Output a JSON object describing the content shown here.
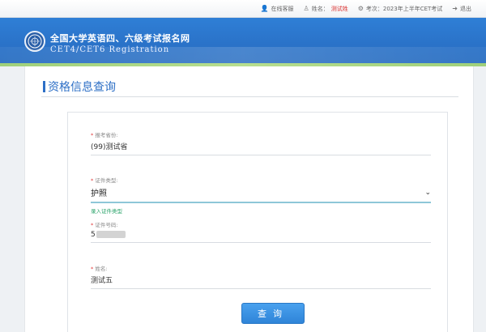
{
  "topbar": {
    "items": [
      {
        "icon": "user-icon",
        "label": "在线客服"
      },
      {
        "icon": "person-icon",
        "label": "姓名：",
        "value": "测试姓"
      },
      {
        "icon": "gear-icon",
        "label": "考次：2023年上半年CET考试"
      },
      {
        "icon": "logout-icon",
        "label": "退出"
      }
    ]
  },
  "brand": {
    "name_cn": "全国大学英语四、六级考试报名网",
    "name_en": "CET4/CET6  Registration"
  },
  "section": {
    "title": "资格信息查询"
  },
  "form": {
    "province": {
      "label": "报考省份",
      "value": "(99)测试省"
    },
    "id_type": {
      "label": "证件类型",
      "value": "护照",
      "hint": "录入证件类型"
    },
    "id_number": {
      "label": "证件号码",
      "value": "5"
    },
    "name": {
      "label": "姓名",
      "value": "测试五"
    },
    "submit_label": "查询"
  }
}
